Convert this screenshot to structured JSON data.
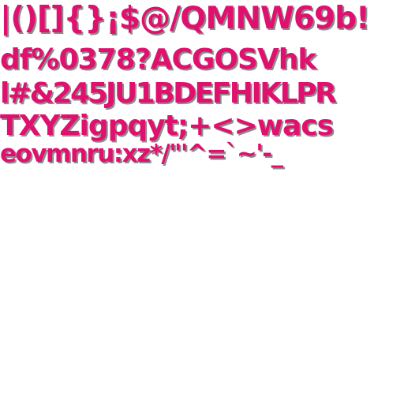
{
  "glyph_sheet": {
    "colors": {
      "glyph_fill": "#e0106f",
      "glyph_shadow": "#8c8c8c",
      "background": "#ffffff"
    },
    "rows": [
      "|()[]{}¡$@/QMNW69b!",
      "df%0378?ACGOSVhk",
      "l#&245JU1BDEFHIKLPR",
      "TXYZigpqyt;+<>wacs",
      "eovmnru:xz*/\"'^=`~'-_"
    ]
  }
}
